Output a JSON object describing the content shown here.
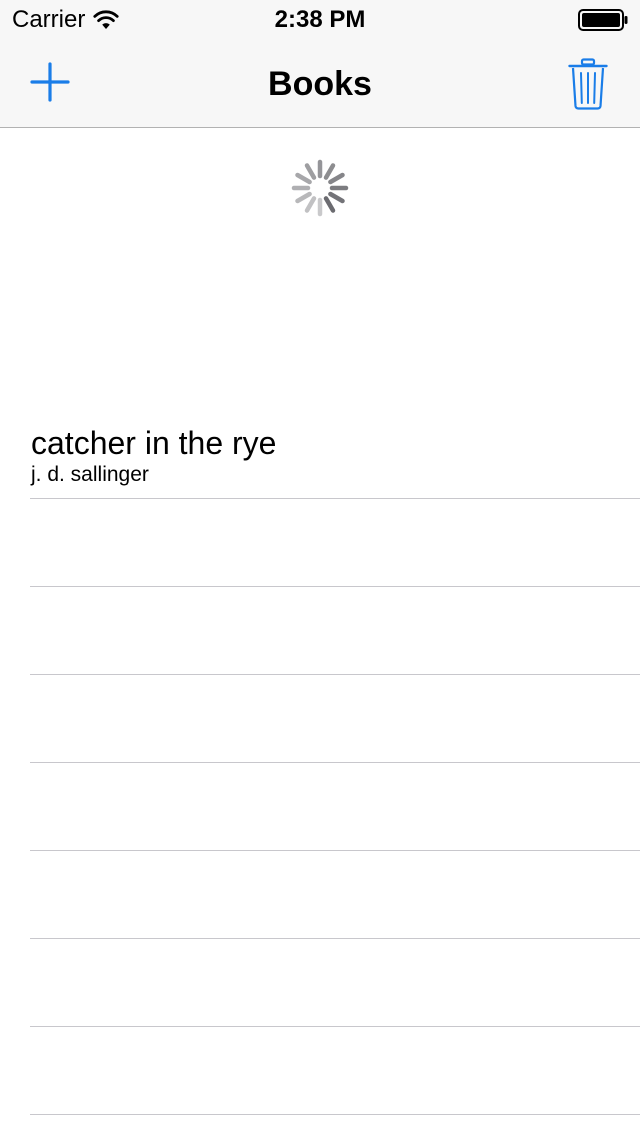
{
  "status_bar": {
    "carrier": "Carrier",
    "time": "2:38 PM",
    "icons": [
      "wifi-icon",
      "battery-icon"
    ]
  },
  "nav_bar": {
    "title": "Books",
    "left_button_icon": "plus-icon",
    "right_button_icon": "trash-icon",
    "tint_color": "#1a7de8"
  },
  "loading_indicator": {
    "icon": "activity-spinner-icon",
    "color": "#6b6b70"
  },
  "books": [
    {
      "title": "catcher in the rye",
      "author": "j. d. sallinger"
    },
    {
      "title": "",
      "author": ""
    },
    {
      "title": "",
      "author": ""
    },
    {
      "title": "",
      "author": ""
    },
    {
      "title": "",
      "author": ""
    },
    {
      "title": "",
      "author": ""
    },
    {
      "title": "",
      "author": ""
    },
    {
      "title": "",
      "author": ""
    }
  ]
}
